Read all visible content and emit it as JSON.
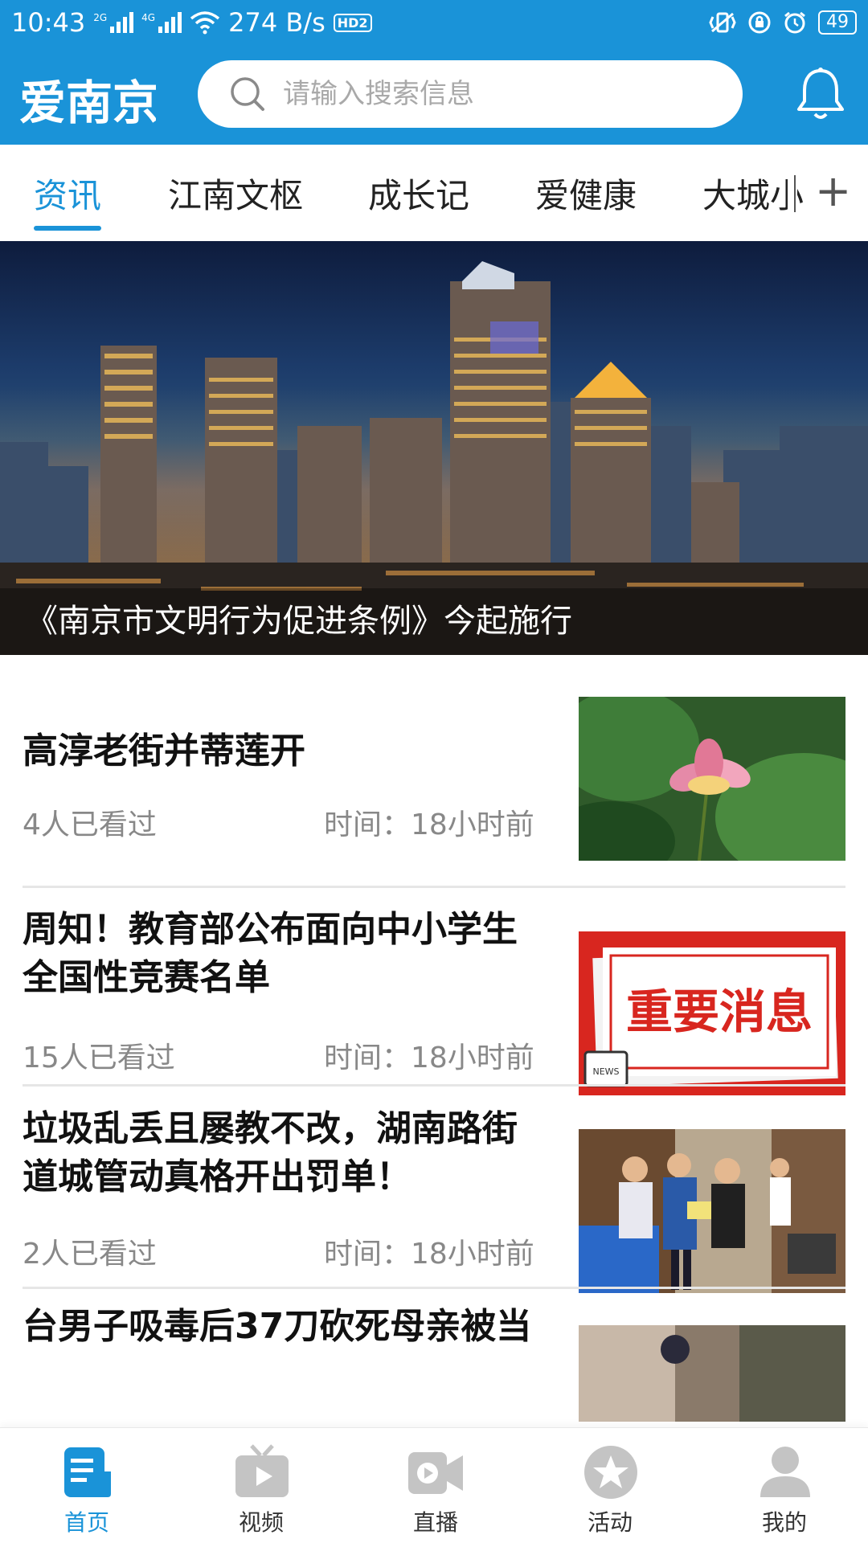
{
  "status_bar": {
    "time": "10:43",
    "network_speed": "274 B/s",
    "hd_label": "HD2",
    "battery": "49",
    "sim1": "2G",
    "sim2": "4G"
  },
  "header": {
    "logo_text": "爱南京",
    "search_placeholder": "请输入搜索信息"
  },
  "tabs": [
    {
      "label": "资讯",
      "active": true
    },
    {
      "label": "江南文枢",
      "active": false
    },
    {
      "label": "成长记",
      "active": false
    },
    {
      "label": "爱健康",
      "active": false
    },
    {
      "label": "大城小",
      "active": false
    }
  ],
  "tabs_add": "+",
  "banner": {
    "caption": "《南京市文明行为促进条例》今起施行"
  },
  "news": [
    {
      "title": "高淳老街并蒂莲开",
      "views": "4人已看过",
      "time": "时间：18小时前",
      "thumb": "lotus-photo"
    },
    {
      "title": "周知！教育部公布面向中小学生全国性竞赛名单",
      "views": "15人已看过",
      "time": "时间：18小时前",
      "thumb": "important-news",
      "thumb_text": "重要消息",
      "thumb_tag": "NEWS"
    },
    {
      "title": "垃圾乱丢且屡教不改，湖南路街道城管动真格开出罚单！",
      "views": "2人已看过",
      "time": "时间：18小时前",
      "thumb": "officers-photo"
    },
    {
      "title": "台男子吸毒后37刀砍死母亲被当",
      "thumb": "partial-photo"
    }
  ],
  "bottom_nav": [
    {
      "label": "首页",
      "icon": "home-doc-icon",
      "active": true
    },
    {
      "label": "视频",
      "icon": "tv-play-icon",
      "active": false
    },
    {
      "label": "直播",
      "icon": "video-camera-icon",
      "active": false
    },
    {
      "label": "活动",
      "icon": "star-icon",
      "active": false
    },
    {
      "label": "我的",
      "icon": "user-icon",
      "active": false
    }
  ],
  "colors": {
    "brand": "#1a93d8",
    "inactive_icon": "#c4c4c4",
    "news_red": "#d8261f"
  }
}
